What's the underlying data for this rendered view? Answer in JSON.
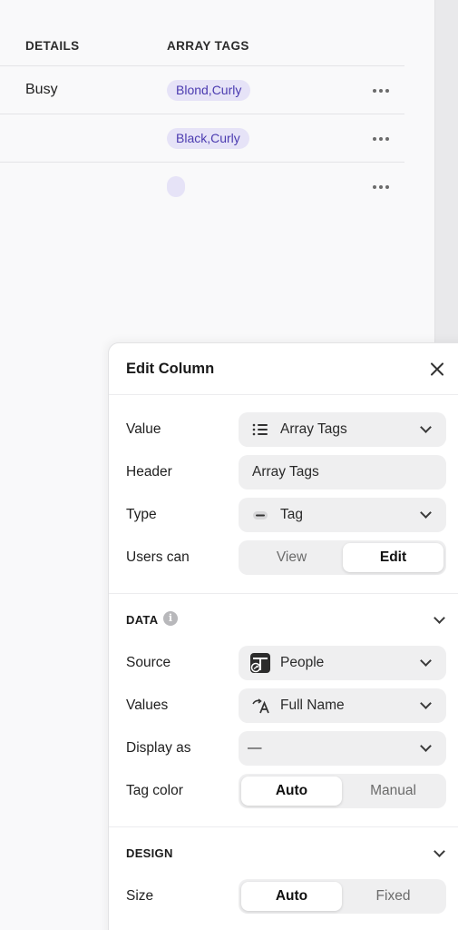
{
  "table": {
    "headers": {
      "details": "DETAILS",
      "array_tags": "ARRAY TAGS"
    },
    "rows": [
      {
        "details": "Busy",
        "tag": "Blond,Curly"
      },
      {
        "details": "",
        "tag": "Black,Curly"
      },
      {
        "details": "",
        "tag": ""
      }
    ]
  },
  "panel": {
    "title": "Edit Column",
    "general": {
      "value_label": "Value",
      "value": "Array Tags",
      "value_icon": "list-icon",
      "header_label": "Header",
      "header": "Array Tags",
      "type_label": "Type",
      "type": "Tag",
      "type_icon": "tag-pill-icon",
      "users_can_label": "Users can",
      "users_can_options": [
        "View",
        "Edit"
      ],
      "users_can_selected": "Edit"
    },
    "data": {
      "section_title": "DATA",
      "source_label": "Source",
      "source": "People",
      "source_icon": "table-link-icon",
      "values_label": "Values",
      "values": "Full Name",
      "values_icon": "text-arrow-icon",
      "display_as_label": "Display as",
      "display_as": "—",
      "tag_color_label": "Tag color",
      "tag_color_options": [
        "Auto",
        "Manual"
      ],
      "tag_color_selected": "Auto"
    },
    "design": {
      "section_title": "DESIGN",
      "size_label": "Size",
      "size_options": [
        "Auto",
        "Fixed"
      ],
      "size_selected": "Auto"
    }
  },
  "colors": {
    "tag_bg": "#e6e3f7",
    "tag_text": "#4b3bb0",
    "panel_bg": "#ffffff",
    "control_bg": "#efeff0"
  }
}
